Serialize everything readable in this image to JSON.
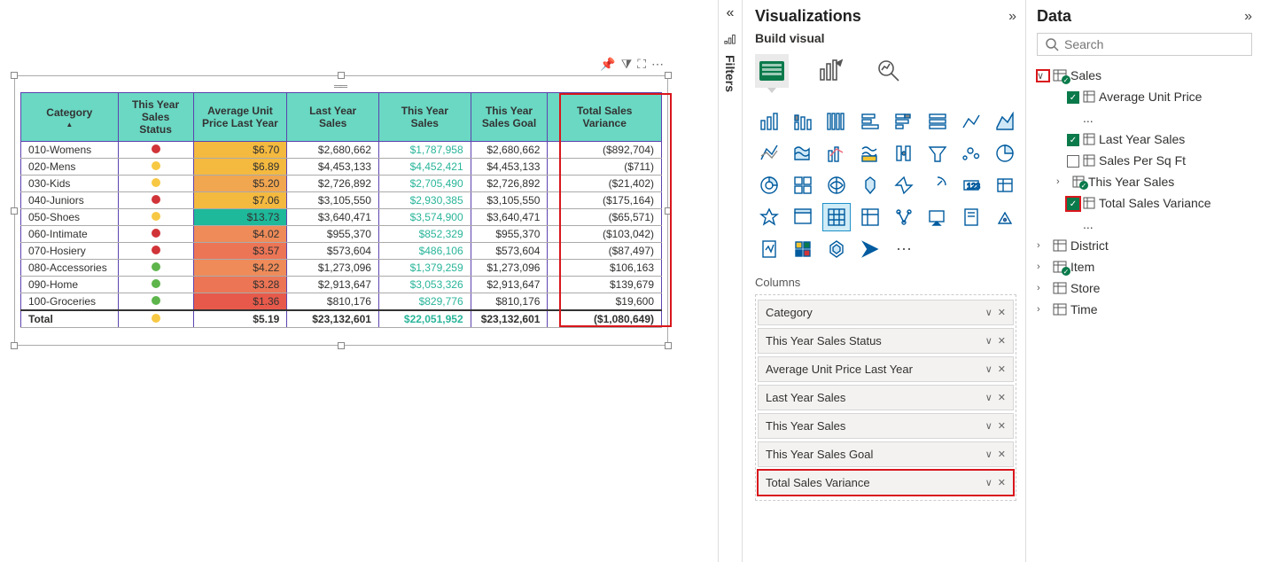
{
  "panes": {
    "visualizations": "Visualizations",
    "build_visual": "Build visual",
    "columns": "Columns",
    "data": "Data",
    "filters": "Filters",
    "search_placeholder": "Search"
  },
  "table": {
    "headers": {
      "category": "Category",
      "status": "This Year Sales Status",
      "avg": "Average Unit Price Last Year",
      "ly": "Last Year Sales",
      "ty": "This Year Sales",
      "goal": "This Year Sales Goal",
      "var": "Total Sales Variance"
    },
    "rows": [
      {
        "cat": "010-Womens",
        "status": "red",
        "avg": "$6.70",
        "avg_bg": "#f4b93f",
        "ly": "$2,680,662",
        "ty": "$1,787,958",
        "goal": "$2,680,662",
        "var": "($892,704)"
      },
      {
        "cat": "020-Mens",
        "status": "yellow",
        "avg": "$6.89",
        "avg_bg": "#f4b93f",
        "ly": "$4,453,133",
        "ty": "$4,452,421",
        "goal": "$4,453,133",
        "var": "($711)"
      },
      {
        "cat": "030-Kids",
        "status": "yellow",
        "avg": "$5.20",
        "avg_bg": "#f1a650",
        "ly": "$2,726,892",
        "ty": "$2,705,490",
        "goal": "$2,726,892",
        "var": "($21,402)"
      },
      {
        "cat": "040-Juniors",
        "status": "red",
        "avg": "$7.06",
        "avg_bg": "#f4b93f",
        "ly": "$3,105,550",
        "ty": "$2,930,385",
        "goal": "$3,105,550",
        "var": "($175,164)"
      },
      {
        "cat": "050-Shoes",
        "status": "yellow",
        "avg": "$13.73",
        "avg_bg": "#1eb89a",
        "ly": "$3,640,471",
        "ty": "$3,574,900",
        "goal": "$3,640,471",
        "var": "($65,571)"
      },
      {
        "cat": "060-Intimate",
        "status": "red",
        "avg": "$4.02",
        "avg_bg": "#ee8b59",
        "ly": "$955,370",
        "ty": "$852,329",
        "goal": "$955,370",
        "var": "($103,042)"
      },
      {
        "cat": "070-Hosiery",
        "status": "red",
        "avg": "$3.57",
        "avg_bg": "#ec7556",
        "ly": "$573,604",
        "ty": "$486,106",
        "goal": "$573,604",
        "var": "($87,497)"
      },
      {
        "cat": "080-Accessories",
        "status": "green",
        "avg": "$4.22",
        "avg_bg": "#ee8b59",
        "ly": "$1,273,096",
        "ty": "$1,379,259",
        "goal": "$1,273,096",
        "var": "$106,163"
      },
      {
        "cat": "090-Home",
        "status": "green",
        "avg": "$3.28",
        "avg_bg": "#ec7556",
        "ly": "$2,913,647",
        "ty": "$3,053,326",
        "goal": "$2,913,647",
        "var": "$139,679"
      },
      {
        "cat": "100-Groceries",
        "status": "green",
        "avg": "$1.36",
        "avg_bg": "#e75a4b",
        "ly": "$810,176",
        "ty": "$829,776",
        "goal": "$810,176",
        "var": "$19,600"
      }
    ],
    "total": {
      "label": "Total",
      "status": "yellow",
      "avg": "$5.19",
      "ly": "$23,132,601",
      "ty": "$22,051,952",
      "goal": "$23,132,601",
      "var": "($1,080,649)"
    }
  },
  "column_fields": [
    {
      "label": "Category",
      "hl": false
    },
    {
      "label": "This Year Sales Status",
      "hl": false
    },
    {
      "label": "Average Unit Price Last Year",
      "hl": false
    },
    {
      "label": "Last Year Sales",
      "hl": false
    },
    {
      "label": "This Year Sales",
      "hl": false
    },
    {
      "label": "This Year Sales Goal",
      "hl": false
    },
    {
      "label": "Total Sales Variance",
      "hl": true
    }
  ],
  "data_tree": {
    "sales": "Sales",
    "avg_unit_price": "Average Unit Price",
    "last_year_sales": "Last Year Sales",
    "sales_per_sqft": "Sales Per Sq Ft",
    "this_year_sales": "This Year Sales",
    "total_sales_variance": "Total Sales Variance",
    "district": "District",
    "item": "Item",
    "store": "Store",
    "time": "Time",
    "dots": "..."
  },
  "chart_data": {
    "type": "table",
    "columns": [
      "Category",
      "This Year Sales Status",
      "Average Unit Price Last Year",
      "Last Year Sales",
      "This Year Sales",
      "This Year Sales Goal",
      "Total Sales Variance"
    ],
    "rows": [
      [
        "010-Womens",
        "red",
        6.7,
        2680662,
        1787958,
        2680662,
        -892704
      ],
      [
        "020-Mens",
        "yellow",
        6.89,
        4453133,
        4452421,
        4453133,
        -711
      ],
      [
        "030-Kids",
        "yellow",
        5.2,
        2726892,
        2705490,
        2726892,
        -21402
      ],
      [
        "040-Juniors",
        "red",
        7.06,
        3105550,
        2930385,
        3105550,
        -175164
      ],
      [
        "050-Shoes",
        "yellow",
        13.73,
        3640471,
        3574900,
        3640471,
        -65571
      ],
      [
        "060-Intimate",
        "red",
        4.02,
        955370,
        852329,
        955370,
        -103042
      ],
      [
        "070-Hosiery",
        "red",
        3.57,
        573604,
        486106,
        573604,
        -87497
      ],
      [
        "080-Accessories",
        "green",
        4.22,
        1273096,
        1379259,
        1273096,
        106163
      ],
      [
        "090-Home",
        "green",
        3.28,
        2913647,
        3053326,
        2913647,
        139679
      ],
      [
        "100-Groceries",
        "green",
        1.36,
        810176,
        829776,
        810176,
        19600
      ]
    ],
    "total": [
      "Total",
      "yellow",
      5.19,
      23132601,
      22051952,
      23132601,
      -1080649
    ]
  }
}
